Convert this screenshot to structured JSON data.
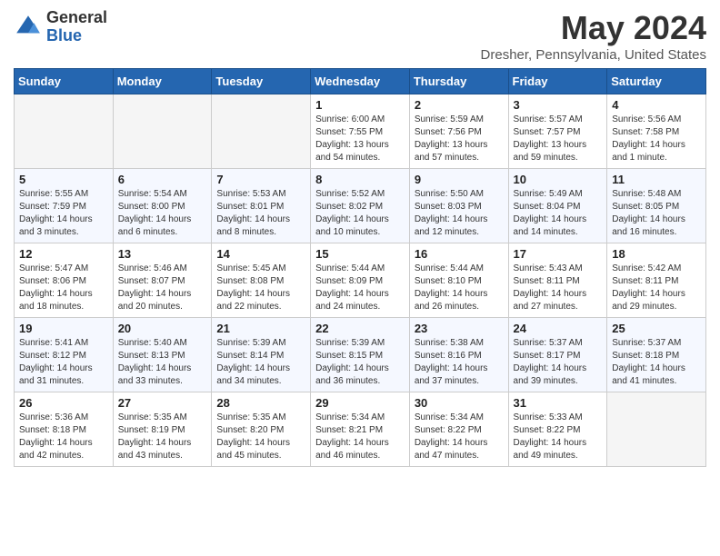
{
  "header": {
    "logo_general": "General",
    "logo_blue": "Blue",
    "title": "May 2024",
    "location": "Dresher, Pennsylvania, United States"
  },
  "weekdays": [
    "Sunday",
    "Monday",
    "Tuesday",
    "Wednesday",
    "Thursday",
    "Friday",
    "Saturday"
  ],
  "weeks": [
    [
      {
        "day": "",
        "empty": true
      },
      {
        "day": "",
        "empty": true
      },
      {
        "day": "",
        "empty": true
      },
      {
        "day": "1",
        "sunrise": "Sunrise: 6:00 AM",
        "sunset": "Sunset: 7:55 PM",
        "daylight": "Daylight: 13 hours and 54 minutes."
      },
      {
        "day": "2",
        "sunrise": "Sunrise: 5:59 AM",
        "sunset": "Sunset: 7:56 PM",
        "daylight": "Daylight: 13 hours and 57 minutes."
      },
      {
        "day": "3",
        "sunrise": "Sunrise: 5:57 AM",
        "sunset": "Sunset: 7:57 PM",
        "daylight": "Daylight: 13 hours and 59 minutes."
      },
      {
        "day": "4",
        "sunrise": "Sunrise: 5:56 AM",
        "sunset": "Sunset: 7:58 PM",
        "daylight": "Daylight: 14 hours and 1 minute."
      }
    ],
    [
      {
        "day": "5",
        "sunrise": "Sunrise: 5:55 AM",
        "sunset": "Sunset: 7:59 PM",
        "daylight": "Daylight: 14 hours and 3 minutes."
      },
      {
        "day": "6",
        "sunrise": "Sunrise: 5:54 AM",
        "sunset": "Sunset: 8:00 PM",
        "daylight": "Daylight: 14 hours and 6 minutes."
      },
      {
        "day": "7",
        "sunrise": "Sunrise: 5:53 AM",
        "sunset": "Sunset: 8:01 PM",
        "daylight": "Daylight: 14 hours and 8 minutes."
      },
      {
        "day": "8",
        "sunrise": "Sunrise: 5:52 AM",
        "sunset": "Sunset: 8:02 PM",
        "daylight": "Daylight: 14 hours and 10 minutes."
      },
      {
        "day": "9",
        "sunrise": "Sunrise: 5:50 AM",
        "sunset": "Sunset: 8:03 PM",
        "daylight": "Daylight: 14 hours and 12 minutes."
      },
      {
        "day": "10",
        "sunrise": "Sunrise: 5:49 AM",
        "sunset": "Sunset: 8:04 PM",
        "daylight": "Daylight: 14 hours and 14 minutes."
      },
      {
        "day": "11",
        "sunrise": "Sunrise: 5:48 AM",
        "sunset": "Sunset: 8:05 PM",
        "daylight": "Daylight: 14 hours and 16 minutes."
      }
    ],
    [
      {
        "day": "12",
        "sunrise": "Sunrise: 5:47 AM",
        "sunset": "Sunset: 8:06 PM",
        "daylight": "Daylight: 14 hours and 18 minutes."
      },
      {
        "day": "13",
        "sunrise": "Sunrise: 5:46 AM",
        "sunset": "Sunset: 8:07 PM",
        "daylight": "Daylight: 14 hours and 20 minutes."
      },
      {
        "day": "14",
        "sunrise": "Sunrise: 5:45 AM",
        "sunset": "Sunset: 8:08 PM",
        "daylight": "Daylight: 14 hours and 22 minutes."
      },
      {
        "day": "15",
        "sunrise": "Sunrise: 5:44 AM",
        "sunset": "Sunset: 8:09 PM",
        "daylight": "Daylight: 14 hours and 24 minutes."
      },
      {
        "day": "16",
        "sunrise": "Sunrise: 5:44 AM",
        "sunset": "Sunset: 8:10 PM",
        "daylight": "Daylight: 14 hours and 26 minutes."
      },
      {
        "day": "17",
        "sunrise": "Sunrise: 5:43 AM",
        "sunset": "Sunset: 8:11 PM",
        "daylight": "Daylight: 14 hours and 27 minutes."
      },
      {
        "day": "18",
        "sunrise": "Sunrise: 5:42 AM",
        "sunset": "Sunset: 8:11 PM",
        "daylight": "Daylight: 14 hours and 29 minutes."
      }
    ],
    [
      {
        "day": "19",
        "sunrise": "Sunrise: 5:41 AM",
        "sunset": "Sunset: 8:12 PM",
        "daylight": "Daylight: 14 hours and 31 minutes."
      },
      {
        "day": "20",
        "sunrise": "Sunrise: 5:40 AM",
        "sunset": "Sunset: 8:13 PM",
        "daylight": "Daylight: 14 hours and 33 minutes."
      },
      {
        "day": "21",
        "sunrise": "Sunrise: 5:39 AM",
        "sunset": "Sunset: 8:14 PM",
        "daylight": "Daylight: 14 hours and 34 minutes."
      },
      {
        "day": "22",
        "sunrise": "Sunrise: 5:39 AM",
        "sunset": "Sunset: 8:15 PM",
        "daylight": "Daylight: 14 hours and 36 minutes."
      },
      {
        "day": "23",
        "sunrise": "Sunrise: 5:38 AM",
        "sunset": "Sunset: 8:16 PM",
        "daylight": "Daylight: 14 hours and 37 minutes."
      },
      {
        "day": "24",
        "sunrise": "Sunrise: 5:37 AM",
        "sunset": "Sunset: 8:17 PM",
        "daylight": "Daylight: 14 hours and 39 minutes."
      },
      {
        "day": "25",
        "sunrise": "Sunrise: 5:37 AM",
        "sunset": "Sunset: 8:18 PM",
        "daylight": "Daylight: 14 hours and 41 minutes."
      }
    ],
    [
      {
        "day": "26",
        "sunrise": "Sunrise: 5:36 AM",
        "sunset": "Sunset: 8:18 PM",
        "daylight": "Daylight: 14 hours and 42 minutes."
      },
      {
        "day": "27",
        "sunrise": "Sunrise: 5:35 AM",
        "sunset": "Sunset: 8:19 PM",
        "daylight": "Daylight: 14 hours and 43 minutes."
      },
      {
        "day": "28",
        "sunrise": "Sunrise: 5:35 AM",
        "sunset": "Sunset: 8:20 PM",
        "daylight": "Daylight: 14 hours and 45 minutes."
      },
      {
        "day": "29",
        "sunrise": "Sunrise: 5:34 AM",
        "sunset": "Sunset: 8:21 PM",
        "daylight": "Daylight: 14 hours and 46 minutes."
      },
      {
        "day": "30",
        "sunrise": "Sunrise: 5:34 AM",
        "sunset": "Sunset: 8:22 PM",
        "daylight": "Daylight: 14 hours and 47 minutes."
      },
      {
        "day": "31",
        "sunrise": "Sunrise: 5:33 AM",
        "sunset": "Sunset: 8:22 PM",
        "daylight": "Daylight: 14 hours and 49 minutes."
      },
      {
        "day": "",
        "empty": true
      }
    ]
  ]
}
